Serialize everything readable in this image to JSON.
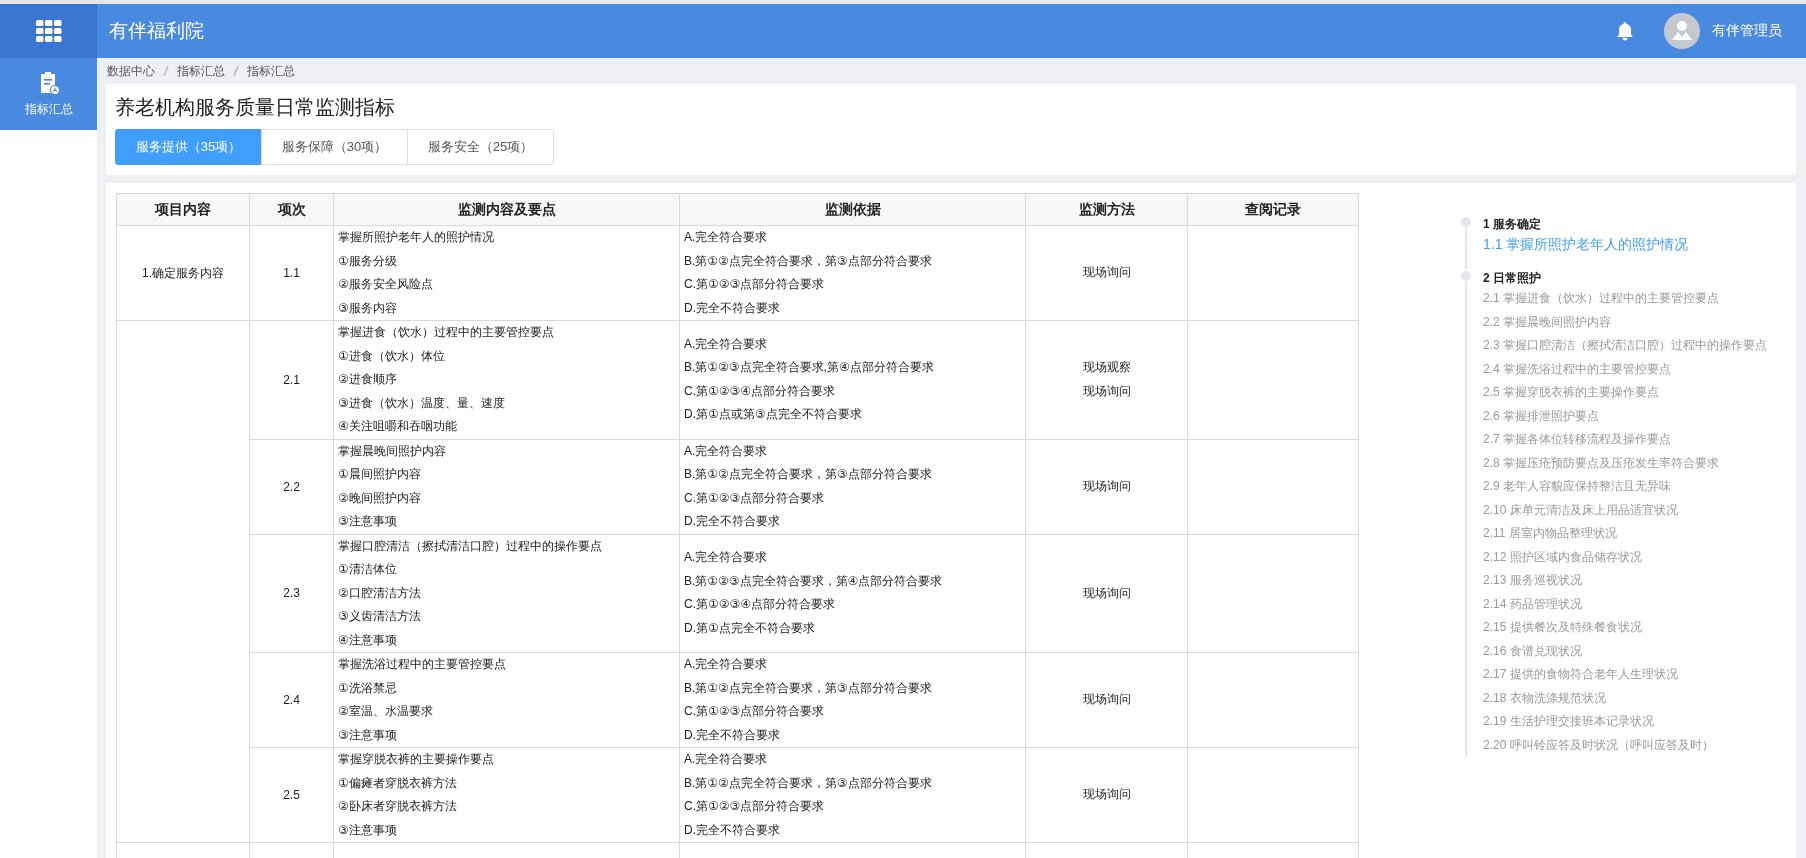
{
  "header": {
    "app_title": "有伴福利院",
    "user_name": "有伴管理员"
  },
  "sidebar": {
    "items": [
      {
        "label": "指标汇总",
        "selected": true
      }
    ]
  },
  "breadcrumb": [
    "数据中心",
    "指标汇总",
    "指标汇总"
  ],
  "page_title": "养老机构服务质量日常监测指标",
  "tabs": [
    {
      "label": "服务提供（35项）",
      "selected": true
    },
    {
      "label": "服务保障（30项）",
      "selected": false
    },
    {
      "label": "服务安全（25项）",
      "selected": false
    }
  ],
  "table": {
    "columns": [
      "项目内容",
      "项次",
      "监测内容及要点",
      "监测依据",
      "监测方法",
      "查阅记录"
    ],
    "groups": [
      {
        "category": "1.确定服务内容",
        "rows": [
          {
            "index": "1.1",
            "points": [
              "掌握所照护老年人的照护情况",
              "①服务分级",
              "②服务安全风险点",
              "③服务内容"
            ],
            "criteria": [
              "A.完全符合要求",
              "B.第①②点完全符合要求，第③点部分符合要求",
              "C.第①②③点部分符合要求",
              "D.完全不符合要求"
            ],
            "methods": [
              "现场询问"
            ]
          }
        ]
      },
      {
        "rows": [
          {
            "index": "2.1",
            "points": [
              "掌握进食（饮水）过程中的主要管控要点",
              "①进食（饮水）体位",
              "②进食顺序",
              "③进食（饮水）温度、量、速度",
              "④关注咀嚼和吞咽功能"
            ],
            "criteria": [
              "A.完全符合要求",
              "B.第①②③点完全符合要求,第④点部分符合要求",
              "C.第①②③④点部分符合要求",
              "D.第①点或第③点完全不符合要求"
            ],
            "methods": [
              "现场观察",
              "现场询问"
            ]
          },
          {
            "index": "2.2",
            "points": [
              "掌握晨晚间照护内容",
              "①晨间照护内容",
              "②晚间照护内容",
              "③注意事项"
            ],
            "criteria": [
              "A.完全符合要求",
              "B.第①②点完全符合要求，第③点部分符合要求",
              "C.第①②③点部分符合要求",
              "D.完全不符合要求"
            ],
            "methods": [
              "现场询问"
            ]
          },
          {
            "index": "2.3",
            "points": [
              "掌握口腔清洁（擦拭清洁口腔）过程中的操作要点",
              "①清洁体位",
              "②口腔清洁方法",
              "③义齿清洁方法",
              "④注意事项"
            ],
            "criteria": [
              "A.完全符合要求",
              "B.第①②③点完全符合要求，第④点部分符合要求",
              "C.第①②③④点部分符合要求",
              "D.第①点完全不符合要求"
            ],
            "methods": [
              "现场询问"
            ]
          },
          {
            "index": "2.4",
            "points": [
              "掌握洗浴过程中的主要管控要点",
              "①洗浴禁忌",
              "②室温、水温要求",
              "③注意事项"
            ],
            "criteria": [
              "A.完全符合要求",
              "B.第①②点完全符合要求，第③点部分符合要求",
              "C.第①②③点部分符合要求",
              "D.完全不符合要求"
            ],
            "methods": [
              "现场询问"
            ]
          },
          {
            "index": "2.5",
            "points": [
              "掌握穿脱衣裤的主要操作要点",
              "①偏瘫者穿脱衣裤方法",
              "②卧床者穿脱衣裤方法",
              "③注意事项"
            ],
            "criteria": [
              "A.完全符合要求",
              "B.第①②点完全符合要求，第③点部分符合要求",
              "C.第①②③点部分符合要求",
              "D.完全不符合要求"
            ],
            "methods": [
              "现场询问"
            ]
          }
        ]
      }
    ]
  },
  "toc": [
    {
      "label": "1 服务确定",
      "children": [
        {
          "label": "1.1  掌握所照护老年人的照护情况",
          "selected": true
        }
      ]
    },
    {
      "label": "2 日常照护",
      "children": [
        {
          "label": "2.1  掌握进食（饮水）过程中的主要管控要点",
          "selected": false
        },
        {
          "label": "2.2  掌握晨晚间照护内容",
          "selected": false
        },
        {
          "label": "2.3  掌握口腔清洁（擦拭清洁口腔）过程中的操作要点",
          "selected": false
        },
        {
          "label": "2.4  掌握洗浴过程中的主要管控要点",
          "selected": false
        },
        {
          "label": "2.5  掌握穿脱衣裤的主要操作要点",
          "selected": false
        },
        {
          "label": "2.6  掌握排泄照护要点",
          "selected": false
        },
        {
          "label": "2.7  掌握各体位转移流程及操作要点",
          "selected": false
        },
        {
          "label": "2.8  掌握压疮预防要点及压疮发生率符合要求",
          "selected": false
        },
        {
          "label": "2.9  老年人容貌应保持整洁且无异味",
          "selected": false
        },
        {
          "label": "2.10  床单元清洁及床上用品适宜状况",
          "selected": false
        },
        {
          "label": "2.11  居室内物品整理状况",
          "selected": false
        },
        {
          "label": "2.12  照护区域内食品储存状况",
          "selected": false
        },
        {
          "label": "2.13  服务巡视状况",
          "selected": false
        },
        {
          "label": "2.14  药品管理状况",
          "selected": false
        },
        {
          "label": "2.15  提供餐次及特殊餐食状况",
          "selected": false
        },
        {
          "label": "2.16  食谱兑现状况",
          "selected": false
        },
        {
          "label": "2.17  提供的食物符合老年人生理状况",
          "selected": false
        },
        {
          "label": "2.18  衣物洗涤规范状况",
          "selected": false
        },
        {
          "label": "2.19  生活护理交接班本记录状况",
          "selected": false
        },
        {
          "label": "2.20  呼叫铃应答及时状况（呼叫应答及时）",
          "selected": false
        }
      ]
    }
  ]
}
